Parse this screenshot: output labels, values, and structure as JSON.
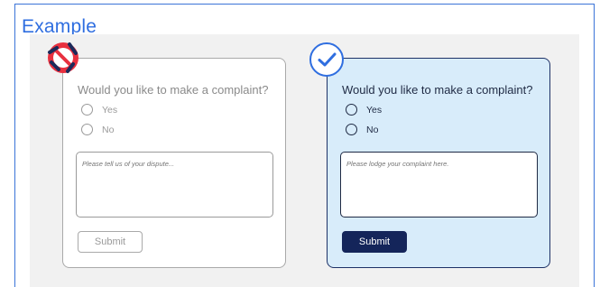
{
  "heading": "Example",
  "bad_example": {
    "question": "Would you like to make a complaint?",
    "options": [
      "Yes",
      "No"
    ],
    "textarea_placeholder": "Please tell us of your dispute...",
    "submit_label": "Submit"
  },
  "good_example": {
    "question": "Would you like to make a complaint?",
    "options": [
      "Yes",
      "No"
    ],
    "textarea_placeholder": "Please lodge your complaint here.",
    "submit_label": "Submit"
  },
  "icons": {
    "bad_badge": "prohibited-icon",
    "good_badge": "checkmark-icon"
  },
  "colors": {
    "heading": "#2f6ee0",
    "good_card_bg": "#d8ecfa",
    "good_submit_bg": "#14255a",
    "bad_badge_red": "#e8303f",
    "bad_badge_navy": "#1b2a5a",
    "good_badge_blue": "#2f6ee0"
  }
}
